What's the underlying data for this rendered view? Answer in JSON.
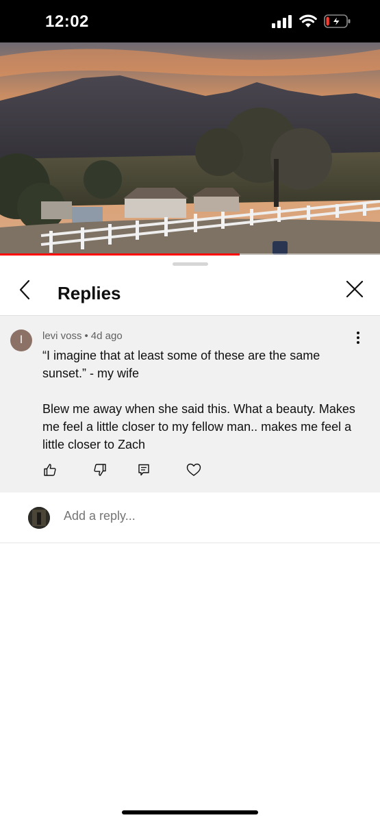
{
  "status_bar": {
    "time": "12:02",
    "signal_icon": "cellular-signal-icon",
    "wifi_icon": "wifi-icon",
    "battery_icon": "battery-charging-icon",
    "battery_level": 0.15,
    "battery_color": "#ff3b30"
  },
  "video": {
    "progress": 0.63,
    "progress_color": "#ff0000"
  },
  "sheet": {
    "title": "Replies",
    "back_icon": "chevron-left-icon",
    "close_icon": "close-icon"
  },
  "comment": {
    "avatar_letter": "l",
    "avatar_color": "#8c7266",
    "author": "levi voss",
    "separator": "•",
    "time": "4d ago",
    "text": "“I imagine that at least some of these are the same sunset.” - my wife\n\nBlew me away when she said this. What a beauty. Makes me feel a little closer to my fellow man.. makes me feel a little closer to Zach",
    "actions": [
      "like-icon",
      "dislike-icon",
      "reply-icon",
      "heart-icon"
    ]
  },
  "reply_box": {
    "placeholder": "Add a reply..."
  }
}
